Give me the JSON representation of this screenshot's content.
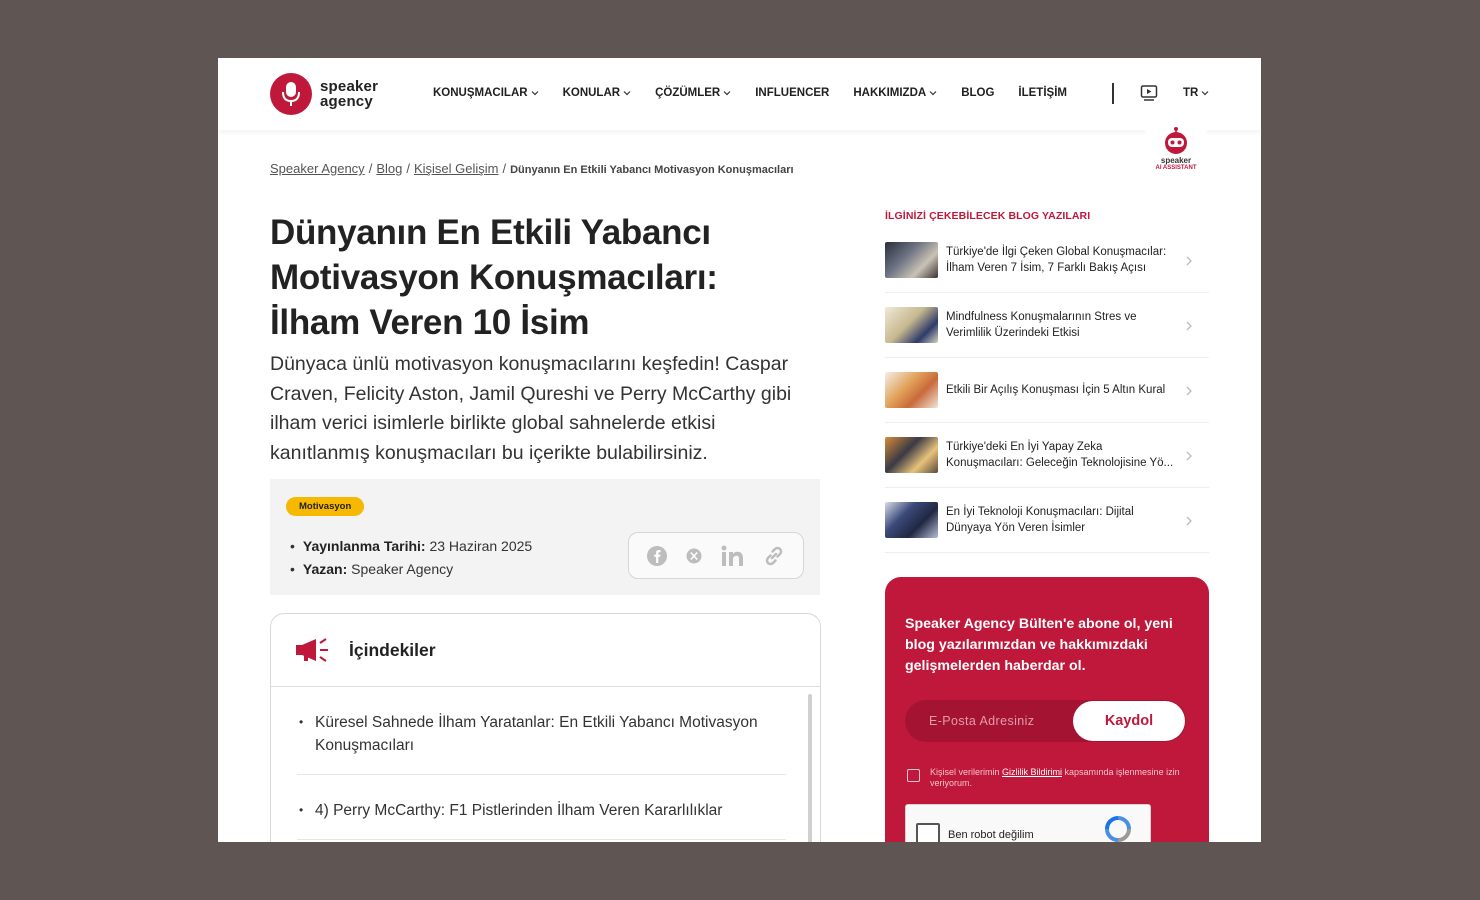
{
  "header": {
    "logo_line1": "speaker",
    "logo_line2": "agency",
    "nav": [
      {
        "label": "KONUŞMACILAR",
        "dropdown": true
      },
      {
        "label": "KONULAR",
        "dropdown": true
      },
      {
        "label": "ÇÖZÜMLER",
        "dropdown": true
      },
      {
        "label": "INFLUENCER",
        "dropdown": false
      },
      {
        "label": "HAKKIMIZDA",
        "dropdown": true
      },
      {
        "label": "BLOG",
        "dropdown": false
      },
      {
        "label": "İLETİŞİM",
        "dropdown": false
      }
    ],
    "lang": "TR",
    "ai_line1": "speaker",
    "ai_line2": "AI ASSISTANT"
  },
  "breadcrumb": {
    "items": [
      "Speaker Agency",
      "Blog",
      "Kişisel Gelişim"
    ],
    "current": "Dünyanın En Etkili Yabancı Motivasyon Konuşmacıları"
  },
  "article": {
    "title": "Dünyanın En Etkili Yabancı Motivasyon Konuşmacıları: İlham Veren 10 İsim",
    "lead": "Dünyaca ünlü motivasyon konuşmacılarını keşfedin! Caspar Craven, Felicity Aston, Jamil Qureshi ve Perry McCarthy gibi ilham verici isimlerle birlikte global sahnelerde etkisi kanıtlanmış konuşmacıları bu içerikte bulabilirsiniz.",
    "tag": "Motivasyon",
    "date_label": "Yayınlanma Tarihi:",
    "date_value": "23 Haziran 2025",
    "author_label": "Yazan:",
    "author_value": "Speaker Agency"
  },
  "toc": {
    "title": "İçindekiler",
    "items": [
      "Küresel Sahnede İlham Yaratanlar: En Etkili Yabancı Motivasyon Konuşmacıları",
      "4) Perry McCarthy: F1 Pistlerinden İlham Veren Kararlılıklar"
    ]
  },
  "sidebar": {
    "title": "İLGİNİZİ ÇEKEBİLECEK BLOG YAZILARI",
    "posts": [
      "Türkiye'de İlgi Çeken Global Konuşmacılar: İlham Veren 7 İsim, 7 Farklı Bakış Açısı",
      "Mindfulness Konuşmalarının Stres ve Verimlilik Üzerindeki Etkisi",
      "Etkili Bir Açılış Konuşması İçin 5 Altın Kural",
      "Türkiye'deki En İyi Yapay Zeka Konuşmacıları: Geleceğin Teknolojisine Yö...",
      "En İyi Teknoloji Konuşmacıları: Dijital Dünyaya Yön Veren İsimler"
    ]
  },
  "newsletter": {
    "text": "Speaker Agency Bülten'e abone ol, yeni blog yazılarımızdan ve hakkımızdaki gelişmelerden haberdar ol.",
    "placeholder": "E-Posta Adresiniz",
    "button": "Kaydol",
    "consent_pre": "Kişisel verilerimin ",
    "consent_link": "Gizlilik Bildirimi",
    "consent_post": " kapsamında işlenmesine izin veriyorum.",
    "captcha": "Ben robot değilim"
  },
  "colors": {
    "brand": "#c0183a",
    "tag": "#f6b800"
  }
}
